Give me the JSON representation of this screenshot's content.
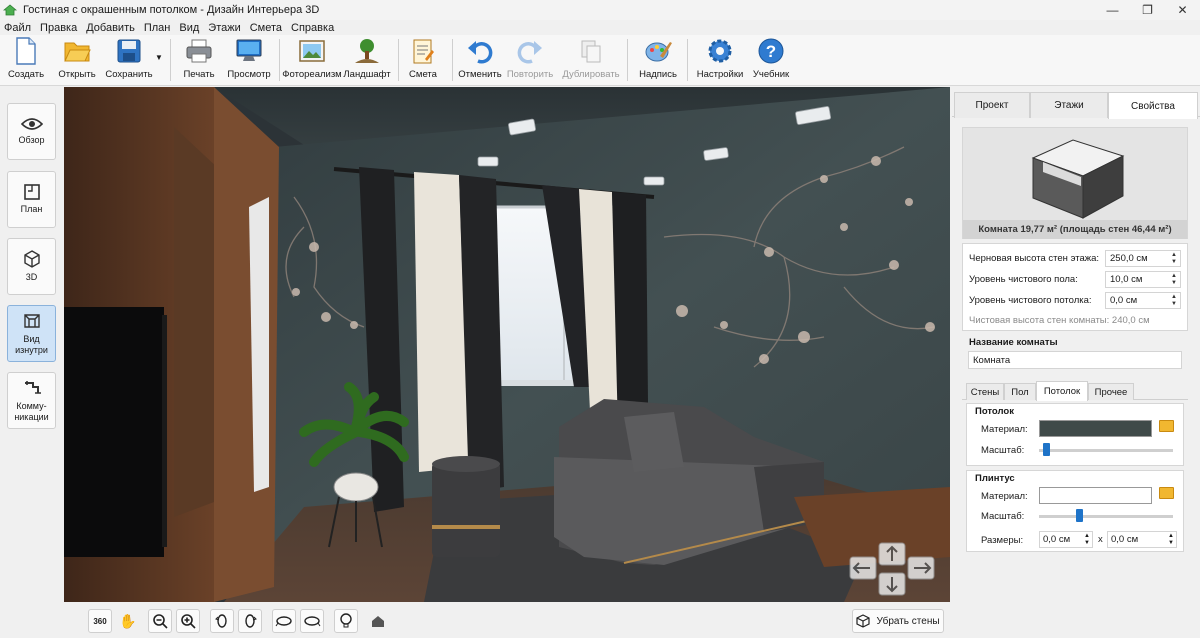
{
  "window": {
    "title": "Гостиная с окрашенным потолком - Дизайн Интерьера 3D",
    "controls": [
      "—",
      "❐",
      "✕"
    ]
  },
  "menu": [
    "Файл",
    "Правка",
    "Добавить",
    "План",
    "Вид",
    "Этажи",
    "Смета",
    "Справка"
  ],
  "toolbar": {
    "create": "Создать",
    "open": "Открыть",
    "save": "Сохранить",
    "print": "Печать",
    "preview": "Просмотр",
    "photorealism": "Фотореализм",
    "landscape": "Ландшафт",
    "estimate": "Смета",
    "undo": "Отменить",
    "redo": "Повторить",
    "duplicate": "Дублировать",
    "label": "Надпись",
    "settings": "Настройки",
    "tutorial": "Учебник"
  },
  "leftnav": {
    "overview": "Обзор",
    "plan": "План",
    "3d": "3D",
    "inside": "Вид\nизнутри",
    "utilities": "Комму-\nникации"
  },
  "bottombar": {
    "rotate360": "360",
    "remove_walls": "Убрать стены"
  },
  "panel": {
    "tabs": [
      "Проект",
      "Этажи",
      "Свойства"
    ],
    "room_caption": "Комната 19,77 м²  (площадь стен 46,44 м²)",
    "fields": [
      {
        "label": "Черновая высота стен этажа:",
        "value": "250,0 см"
      },
      {
        "label": "Уровень чистового пола:",
        "value": "10,0 см"
      },
      {
        "label": "Уровень чистового потолка:",
        "value": "0,0 см"
      }
    ],
    "clean_height": "Чистовая высота стен комнаты: 240,0 см",
    "room_name_label": "Название комнаты",
    "room_name_value": "Комната",
    "subtabs": [
      "Стены",
      "Пол",
      "Потолок",
      "Прочее"
    ],
    "ceiling": {
      "title": "Потолок",
      "material_label": "Материал:",
      "scale_label": "Масштаб:",
      "material_color": "#3f4a49",
      "scale_level": 0.05
    },
    "baseboard": {
      "title": "Плинтус",
      "material_label": "Материал:",
      "scale_label": "Масштаб:",
      "material_color": "#ffffff",
      "scale_level": 0.3,
      "sizes_label": "Размеры:",
      "size_a": "0,0 см",
      "size_x": "x",
      "size_b": "0,0 см"
    }
  },
  "colors": {
    "accent": "#1e73c8",
    "wall": "#3a4547",
    "sofa": "#4a4a4c"
  }
}
